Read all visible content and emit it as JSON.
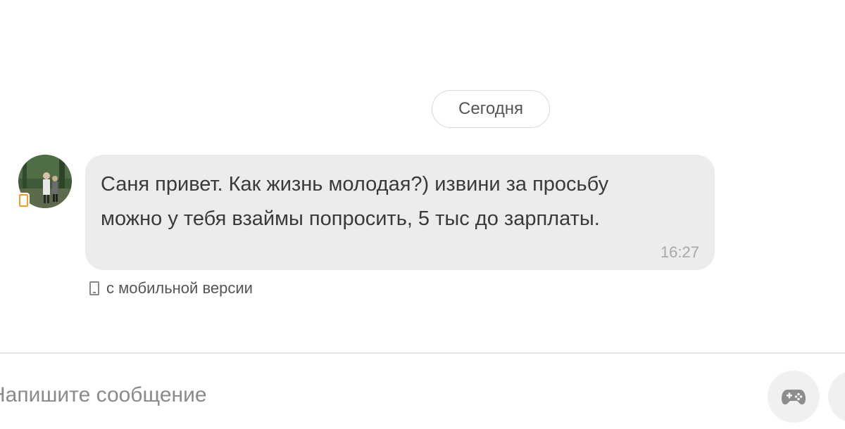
{
  "chat": {
    "date_separator": "Сегодня",
    "messages": [
      {
        "text": "Саня привет. Как жизнь молодая?) извини за просьбу\nможно у тебя взаймы попросить, 5 тыс до зарплаты.",
        "time": "16:27",
        "source_note": "с мобильной версии"
      }
    ]
  },
  "composer": {
    "placeholder": "Напишите сообщение"
  },
  "icons": {
    "avatar": "user-avatar",
    "mobile_badge": "phone-icon",
    "games_button": "gamepad-icon",
    "extra_button": "attach-icon"
  },
  "colors": {
    "accent": "#f59a23",
    "bubble_bg": "#ececec",
    "icon_gray": "#8c8c8c"
  }
}
